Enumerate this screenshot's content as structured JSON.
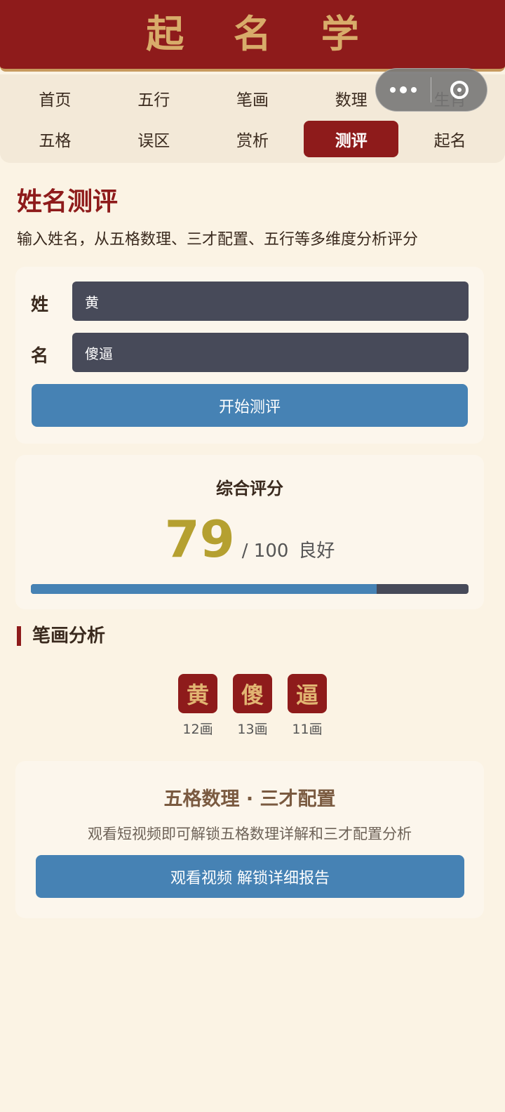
{
  "header": {
    "title": "起 名 学"
  },
  "nav": {
    "row1": [
      "首页",
      "五行",
      "笔画",
      "数理",
      "生肖"
    ],
    "row2": [
      "五格",
      "误区",
      "赏析",
      "测评",
      "起名"
    ],
    "active": "测评"
  },
  "page": {
    "title": "姓名测评",
    "subtitle": "输入姓名，从五格数理、三才配置、五行等多维度分析评分"
  },
  "form": {
    "surname_label": "姓",
    "surname_value": "黄",
    "given_label": "名",
    "given_value": "傻逼",
    "submit_label": "开始测评"
  },
  "score": {
    "title": "综合评分",
    "value": "79",
    "total": "/ 100",
    "grade": "良好",
    "progress_fraction": 0.79
  },
  "strokes": {
    "title": "笔画分析",
    "items": [
      {
        "char": "黄",
        "count": "12画"
      },
      {
        "char": "傻",
        "count": "13画"
      },
      {
        "char": "逼",
        "count": "11画"
      }
    ]
  },
  "locked": {
    "title": "五格数理 · 三才配置",
    "subtitle": "观看短视频即可解锁五格数理详解和三才配置分析",
    "button_label": "观看视频 解锁详细报告"
  },
  "colors": {
    "brand_red": "#8e1b1b",
    "gold": "#d8ac6a",
    "accent_blue": "#4682b4",
    "score_gold": "#b5a030"
  }
}
